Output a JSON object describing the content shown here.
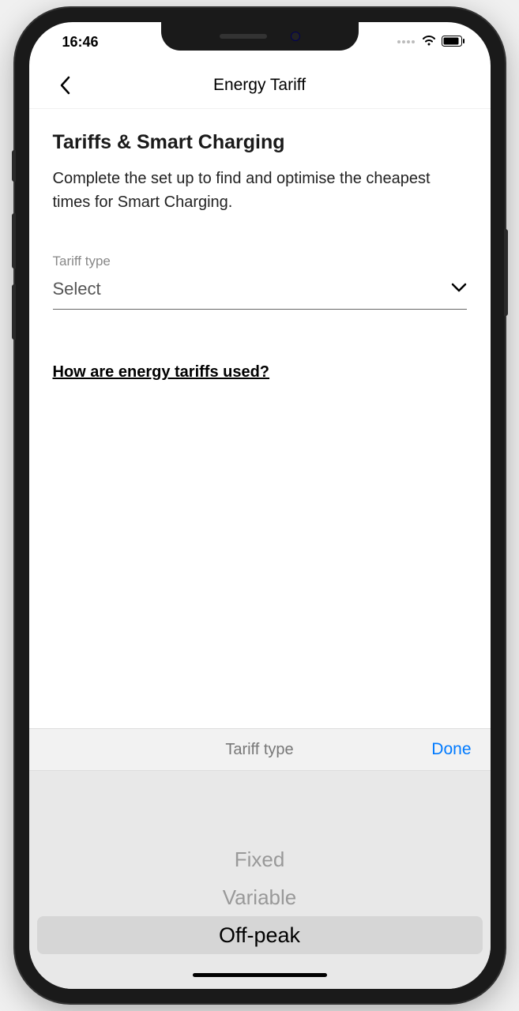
{
  "status": {
    "time": "16:46"
  },
  "nav": {
    "title": "Energy Tariff"
  },
  "content": {
    "heading": "Tariffs & Smart Charging",
    "description": "Complete the set up to find and optimise the cheapest times for Smart Charging.",
    "tariff_field_label": "Tariff type",
    "tariff_field_value": "Select",
    "help_link": "How are energy tariffs used?"
  },
  "picker": {
    "title": "Tariff type",
    "done_label": "Done",
    "options": [
      "Fixed",
      "Variable",
      "Off-peak"
    ],
    "selected": "Off-peak"
  }
}
